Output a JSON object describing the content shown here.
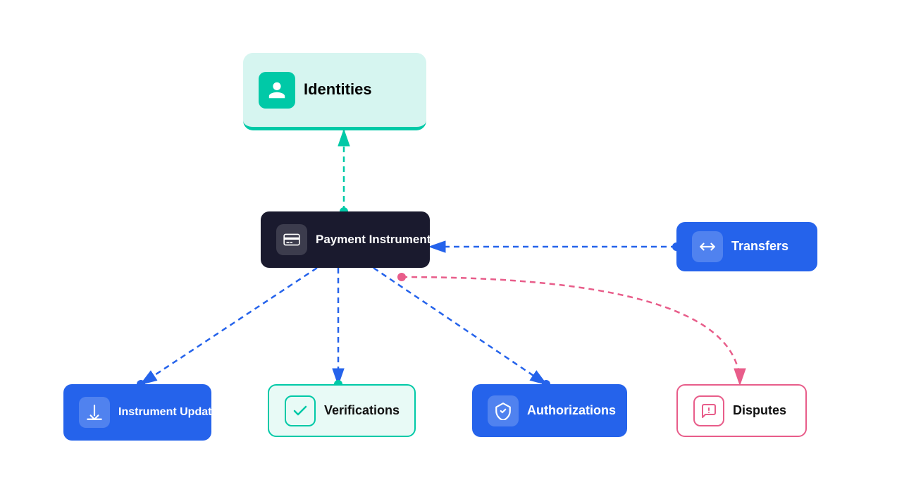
{
  "nodes": {
    "identities": {
      "label": "Identities",
      "icon_type": "person"
    },
    "payment_instruments": {
      "label": "Payment Instruments",
      "icon_type": "terminal"
    },
    "transfers": {
      "label": "Transfers",
      "icon_type": "arrows"
    },
    "instrument_updates": {
      "label": "Instrument Updates",
      "icon_type": "download"
    },
    "verifications": {
      "label": "Verifications",
      "icon_type": "check"
    },
    "authorizations": {
      "label": "Authorizations",
      "icon_type": "shield"
    },
    "disputes": {
      "label": "Disputes",
      "icon_type": "question"
    }
  },
  "colors": {
    "teal": "#00c9a7",
    "blue": "#2563eb",
    "dark": "#1a1a2e",
    "pink": "#e85d8a",
    "white": "#ffffff"
  }
}
